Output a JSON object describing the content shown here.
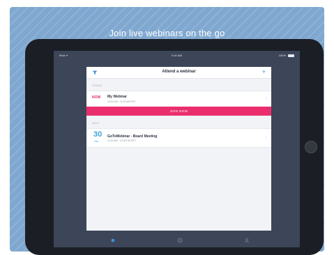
{
  "headline": "Join live webinars on the go",
  "status_bar": {
    "left": "iPad ᯤ",
    "center": "9:41 AM",
    "right": "100%"
  },
  "modal": {
    "title": "Attend a webinar",
    "sections": [
      {
        "label": "TODAY",
        "item": {
          "tag": "NOW",
          "title": "My Webinar",
          "time": "10:00 AM - 11:00 AM PDT"
        }
      },
      {
        "label": "JULY",
        "item": {
          "date_num": "30",
          "date_day": "Sat",
          "title": "GoToWebinar - Board Meeting",
          "time": "11:00 AM - 12:00 PM PDT"
        }
      }
    ],
    "join_button": "JOIN NOW"
  },
  "icons": {
    "filter": "filter-icon",
    "add": "plus-icon",
    "chevron": "chevron-right-icon",
    "tabs": [
      "home-icon",
      "clock-icon",
      "person-icon"
    ]
  },
  "colors": {
    "background": "#7fa7d0",
    "accent_pink": "#ea2e6d",
    "accent_blue": "#3ea6df",
    "device": "#1b1e24",
    "screen": "#3d4558"
  }
}
